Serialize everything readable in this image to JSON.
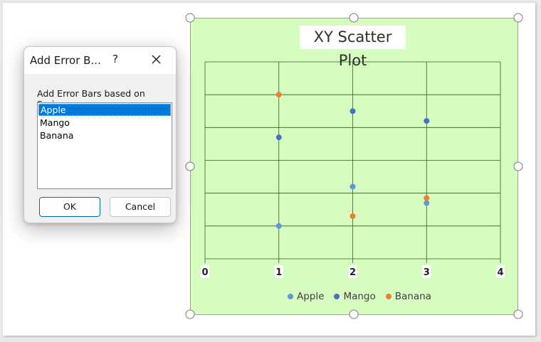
{
  "dialog": {
    "title": "Add Error B...",
    "help_label": "?",
    "close_label": "✕",
    "prompt": "Add Error Bars based on Series:",
    "series_list": [
      "Apple",
      "Mango",
      "Banana"
    ],
    "selected": "Apple",
    "ok_label": "OK",
    "cancel_label": "Cancel"
  },
  "colors": {
    "plot_area": "#d6fcc0",
    "gridline": "#2f5d2f",
    "selection": "#0078d7"
  },
  "chart_data": {
    "type": "scatter",
    "title": "XY Scatter Plot",
    "x_ticks": [
      "0",
      "1",
      "2",
      "3",
      "4"
    ],
    "xlim": [
      0,
      4
    ],
    "ylim": [
      0,
      6
    ],
    "grid": true,
    "legend_position": "bottom",
    "series": [
      {
        "name": "Apple",
        "color": "#5b9bd5",
        "x": [
          1,
          2,
          3
        ],
        "y": [
          1.0,
          2.2,
          1.7
        ]
      },
      {
        "name": "Mango",
        "color": "#4472c4",
        "x": [
          1,
          2,
          3
        ],
        "y": [
          3.7,
          4.5,
          4.2
        ]
      },
      {
        "name": "Banana",
        "color": "#ed7d31",
        "x": [
          1,
          2,
          3
        ],
        "y": [
          5.0,
          1.3,
          1.85
        ]
      }
    ]
  }
}
